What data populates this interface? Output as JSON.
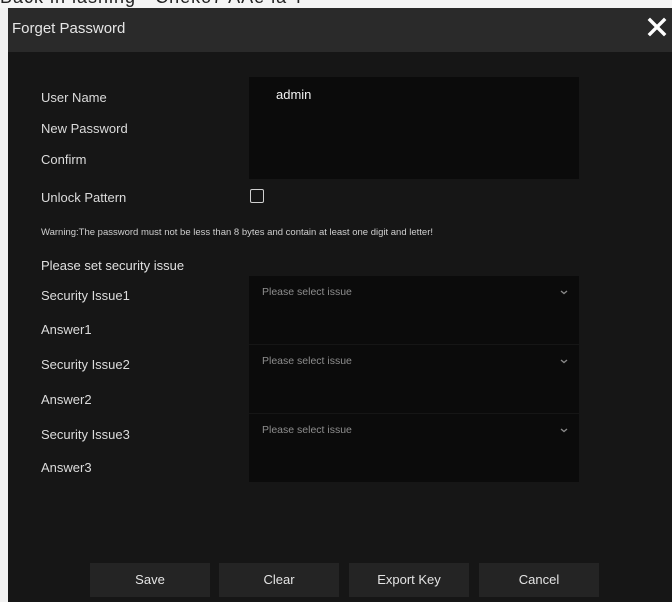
{
  "caption_strip": {
    "text": "Back in lashing · Cheko7 AAe la T"
  },
  "dialog": {
    "title": "Forget Password"
  },
  "form": {
    "user_name_label": "User Name",
    "user_name_value": "admin",
    "new_password_label": "New Password",
    "confirm_label": "Confirm",
    "unlock_pattern_label": "Unlock Pattern",
    "unlock_pattern_checked": false,
    "warning": "Warning:The password must not be less than 8 bytes and contain at least one digit and letter!"
  },
  "security": {
    "section_title": "Please set security issue",
    "items": [
      {
        "issue_label": "Security Issue1",
        "select_placeholder": "Please select issue",
        "answer_label": "Answer1"
      },
      {
        "issue_label": "Security Issue2",
        "select_placeholder": "Please select issue",
        "answer_label": "Answer2"
      },
      {
        "issue_label": "Security Issue3",
        "select_placeholder": "Please select issue",
        "answer_label": "Answer3"
      }
    ]
  },
  "buttons": {
    "save": "Save",
    "clear": "Clear",
    "export_key": "Export Key",
    "cancel": "Cancel"
  },
  "icons": {
    "close": "close-icon",
    "chevron": "chevron-down-icon"
  }
}
